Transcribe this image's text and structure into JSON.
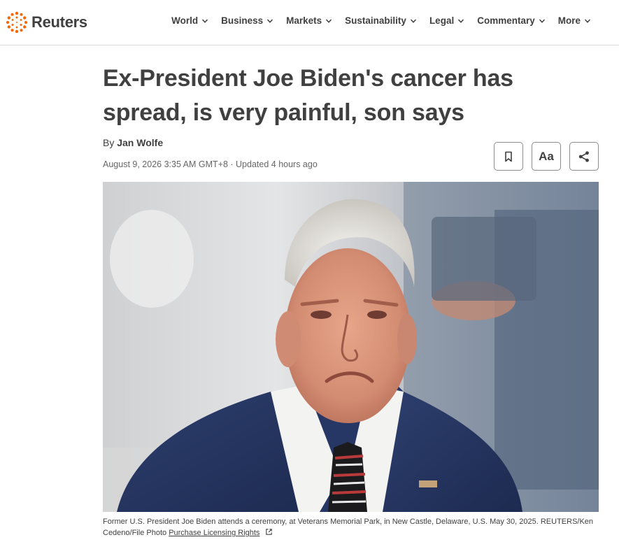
{
  "brand": {
    "name": "Reuters",
    "accent": "#fa6400"
  },
  "nav": {
    "items": [
      {
        "label": "World"
      },
      {
        "label": "Business"
      },
      {
        "label": "Markets"
      },
      {
        "label": "Sustainability"
      },
      {
        "label": "Legal"
      },
      {
        "label": "Commentary"
      },
      {
        "label": "More"
      }
    ],
    "chevron_icon": "chevron-down-icon"
  },
  "article": {
    "headline": "Ex-President Joe Biden's cancer has spread, is very painful, son says",
    "byline_prefix": "By ",
    "author": "Jan Wolfe",
    "dateline": "August 9, 2026 3:35 AM GMT+8 · Updated 4 hours ago",
    "tools": {
      "bookmark_icon": "bookmark-icon",
      "font_size_label": "Aa",
      "share_icon": "share-icon"
    },
    "photo": {
      "caption": "Former U.S. President Joe Biden attends a ceremony, at Veterans Memorial Park, in New Castle, Delaware, U.S. May 30, 2025. REUTERS/Ken Cedeno/File Photo",
      "licensing_link": "Purchase Licensing Rights",
      "external_icon": "external-link-icon"
    }
  }
}
